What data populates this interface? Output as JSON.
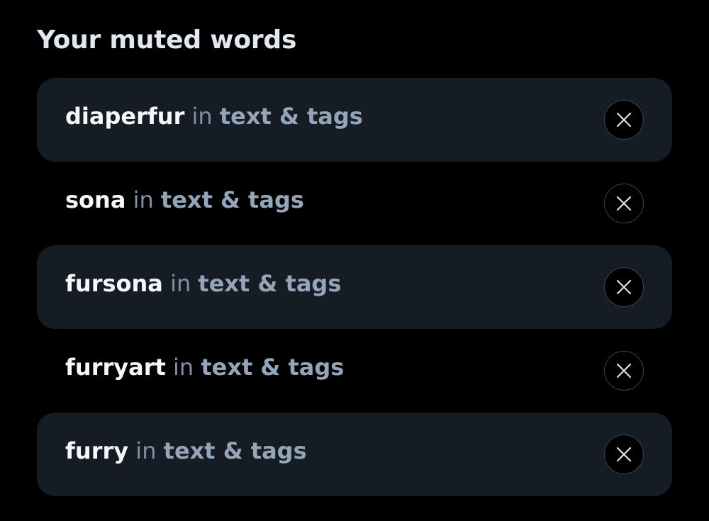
{
  "section": {
    "title": "Your muted words"
  },
  "muted_words": [
    {
      "word": "diaperfur",
      "connector": "in",
      "scope": "text & tags",
      "remove_icon": "close-icon"
    },
    {
      "word": "sona",
      "connector": "in",
      "scope": "text & tags",
      "remove_icon": "close-icon"
    },
    {
      "word": "fursona",
      "connector": "in",
      "scope": "text & tags",
      "remove_icon": "close-icon"
    },
    {
      "word": "furryart",
      "connector": "in",
      "scope": "text & tags",
      "remove_icon": "close-icon"
    },
    {
      "word": "furry",
      "connector": "in",
      "scope": "text & tags",
      "remove_icon": "close-icon"
    }
  ],
  "colors": {
    "background": "#000000",
    "row_shade": "#161c24",
    "word_text": "#f5f7fa",
    "connector_text": "#7f90a5",
    "scope_text": "#94a5ba",
    "button_border": "#3a4452"
  }
}
